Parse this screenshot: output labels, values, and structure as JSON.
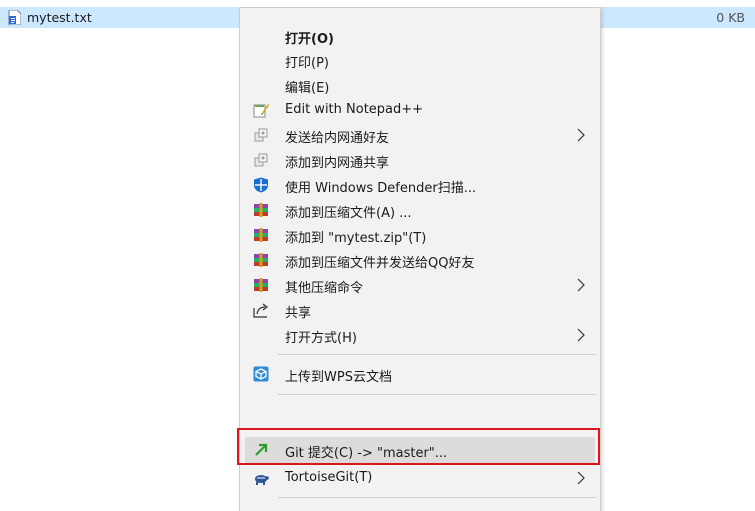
{
  "file": {
    "name": "mytest.txt",
    "size": "0 KB",
    "icon": "text-file-icon"
  },
  "menu": {
    "items": [
      {
        "label": "打开(O)",
        "icon": "",
        "bold": true,
        "submenu": false
      },
      {
        "label": "打印(P)",
        "icon": "",
        "submenu": false
      },
      {
        "label": "编辑(E)",
        "icon": "",
        "submenu": false
      },
      {
        "label": "Edit with Notepad++",
        "icon": "notepad-plus-plus-icon",
        "submenu": false
      },
      {
        "label": "发送给内网通好友",
        "icon": "intranet-share-icon",
        "submenu": true
      },
      {
        "label": "添加到内网通共享",
        "icon": "intranet-share-icon",
        "submenu": false
      },
      {
        "label": "使用 Windows Defender扫描...",
        "icon": "windows-defender-icon",
        "submenu": false
      },
      {
        "label": "添加到压缩文件(A) ...",
        "icon": "winrar-icon",
        "submenu": false
      },
      {
        "label": "添加到 \"mytest.zip\"(T)",
        "icon": "winrar-icon",
        "submenu": false
      },
      {
        "label": "添加到压缩文件并发送给QQ好友",
        "icon": "winrar-icon",
        "submenu": false
      },
      {
        "label": "其他压缩命令",
        "icon": "winrar-icon",
        "submenu": true
      },
      {
        "label": "共享",
        "icon": "share-icon",
        "submenu": false
      },
      {
        "label": "打开方式(H)",
        "icon": "",
        "submenu": true
      },
      {
        "label": "上传到WPS云文档",
        "icon": "wps-cloud-icon",
        "submenu": false
      },
      {
        "label": "Git 提交(C) -> \"master\"...",
        "icon": "git-commit-icon",
        "submenu": false,
        "highlighted": true
      },
      {
        "label": "TortoiseGit(T)",
        "icon": "tortoisegit-icon",
        "submenu": true
      }
    ]
  },
  "colors": {
    "selection": "#cce8ff",
    "menu_bg": "#f2f2f2",
    "hover": "#dcdcdc",
    "highlight_border": "#e0141e"
  }
}
